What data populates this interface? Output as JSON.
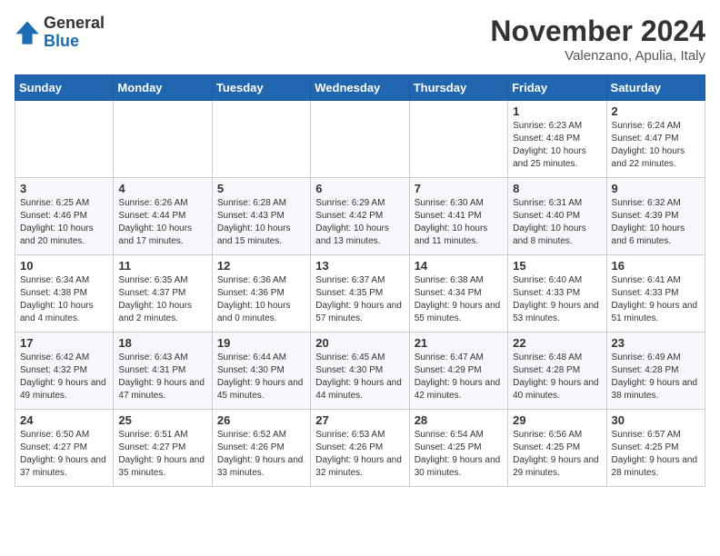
{
  "logo": {
    "general": "General",
    "blue": "Blue"
  },
  "title": "November 2024",
  "subtitle": "Valenzano, Apulia, Italy",
  "weekdays": [
    "Sunday",
    "Monday",
    "Tuesday",
    "Wednesday",
    "Thursday",
    "Friday",
    "Saturday"
  ],
  "weeks": [
    [
      {
        "day": "",
        "info": ""
      },
      {
        "day": "",
        "info": ""
      },
      {
        "day": "",
        "info": ""
      },
      {
        "day": "",
        "info": ""
      },
      {
        "day": "",
        "info": ""
      },
      {
        "day": "1",
        "info": "Sunrise: 6:23 AM\nSunset: 4:48 PM\nDaylight: 10 hours and 25 minutes."
      },
      {
        "day": "2",
        "info": "Sunrise: 6:24 AM\nSunset: 4:47 PM\nDaylight: 10 hours and 22 minutes."
      }
    ],
    [
      {
        "day": "3",
        "info": "Sunrise: 6:25 AM\nSunset: 4:46 PM\nDaylight: 10 hours and 20 minutes."
      },
      {
        "day": "4",
        "info": "Sunrise: 6:26 AM\nSunset: 4:44 PM\nDaylight: 10 hours and 17 minutes."
      },
      {
        "day": "5",
        "info": "Sunrise: 6:28 AM\nSunset: 4:43 PM\nDaylight: 10 hours and 15 minutes."
      },
      {
        "day": "6",
        "info": "Sunrise: 6:29 AM\nSunset: 4:42 PM\nDaylight: 10 hours and 13 minutes."
      },
      {
        "day": "7",
        "info": "Sunrise: 6:30 AM\nSunset: 4:41 PM\nDaylight: 10 hours and 11 minutes."
      },
      {
        "day": "8",
        "info": "Sunrise: 6:31 AM\nSunset: 4:40 PM\nDaylight: 10 hours and 8 minutes."
      },
      {
        "day": "9",
        "info": "Sunrise: 6:32 AM\nSunset: 4:39 PM\nDaylight: 10 hours and 6 minutes."
      }
    ],
    [
      {
        "day": "10",
        "info": "Sunrise: 6:34 AM\nSunset: 4:38 PM\nDaylight: 10 hours and 4 minutes."
      },
      {
        "day": "11",
        "info": "Sunrise: 6:35 AM\nSunset: 4:37 PM\nDaylight: 10 hours and 2 minutes."
      },
      {
        "day": "12",
        "info": "Sunrise: 6:36 AM\nSunset: 4:36 PM\nDaylight: 10 hours and 0 minutes."
      },
      {
        "day": "13",
        "info": "Sunrise: 6:37 AM\nSunset: 4:35 PM\nDaylight: 9 hours and 57 minutes."
      },
      {
        "day": "14",
        "info": "Sunrise: 6:38 AM\nSunset: 4:34 PM\nDaylight: 9 hours and 55 minutes."
      },
      {
        "day": "15",
        "info": "Sunrise: 6:40 AM\nSunset: 4:33 PM\nDaylight: 9 hours and 53 minutes."
      },
      {
        "day": "16",
        "info": "Sunrise: 6:41 AM\nSunset: 4:33 PM\nDaylight: 9 hours and 51 minutes."
      }
    ],
    [
      {
        "day": "17",
        "info": "Sunrise: 6:42 AM\nSunset: 4:32 PM\nDaylight: 9 hours and 49 minutes."
      },
      {
        "day": "18",
        "info": "Sunrise: 6:43 AM\nSunset: 4:31 PM\nDaylight: 9 hours and 47 minutes."
      },
      {
        "day": "19",
        "info": "Sunrise: 6:44 AM\nSunset: 4:30 PM\nDaylight: 9 hours and 45 minutes."
      },
      {
        "day": "20",
        "info": "Sunrise: 6:45 AM\nSunset: 4:30 PM\nDaylight: 9 hours and 44 minutes."
      },
      {
        "day": "21",
        "info": "Sunrise: 6:47 AM\nSunset: 4:29 PM\nDaylight: 9 hours and 42 minutes."
      },
      {
        "day": "22",
        "info": "Sunrise: 6:48 AM\nSunset: 4:28 PM\nDaylight: 9 hours and 40 minutes."
      },
      {
        "day": "23",
        "info": "Sunrise: 6:49 AM\nSunset: 4:28 PM\nDaylight: 9 hours and 38 minutes."
      }
    ],
    [
      {
        "day": "24",
        "info": "Sunrise: 6:50 AM\nSunset: 4:27 PM\nDaylight: 9 hours and 37 minutes."
      },
      {
        "day": "25",
        "info": "Sunrise: 6:51 AM\nSunset: 4:27 PM\nDaylight: 9 hours and 35 minutes."
      },
      {
        "day": "26",
        "info": "Sunrise: 6:52 AM\nSunset: 4:26 PM\nDaylight: 9 hours and 33 minutes."
      },
      {
        "day": "27",
        "info": "Sunrise: 6:53 AM\nSunset: 4:26 PM\nDaylight: 9 hours and 32 minutes."
      },
      {
        "day": "28",
        "info": "Sunrise: 6:54 AM\nSunset: 4:25 PM\nDaylight: 9 hours and 30 minutes."
      },
      {
        "day": "29",
        "info": "Sunrise: 6:56 AM\nSunset: 4:25 PM\nDaylight: 9 hours and 29 minutes."
      },
      {
        "day": "30",
        "info": "Sunrise: 6:57 AM\nSunset: 4:25 PM\nDaylight: 9 hours and 28 minutes."
      }
    ]
  ]
}
